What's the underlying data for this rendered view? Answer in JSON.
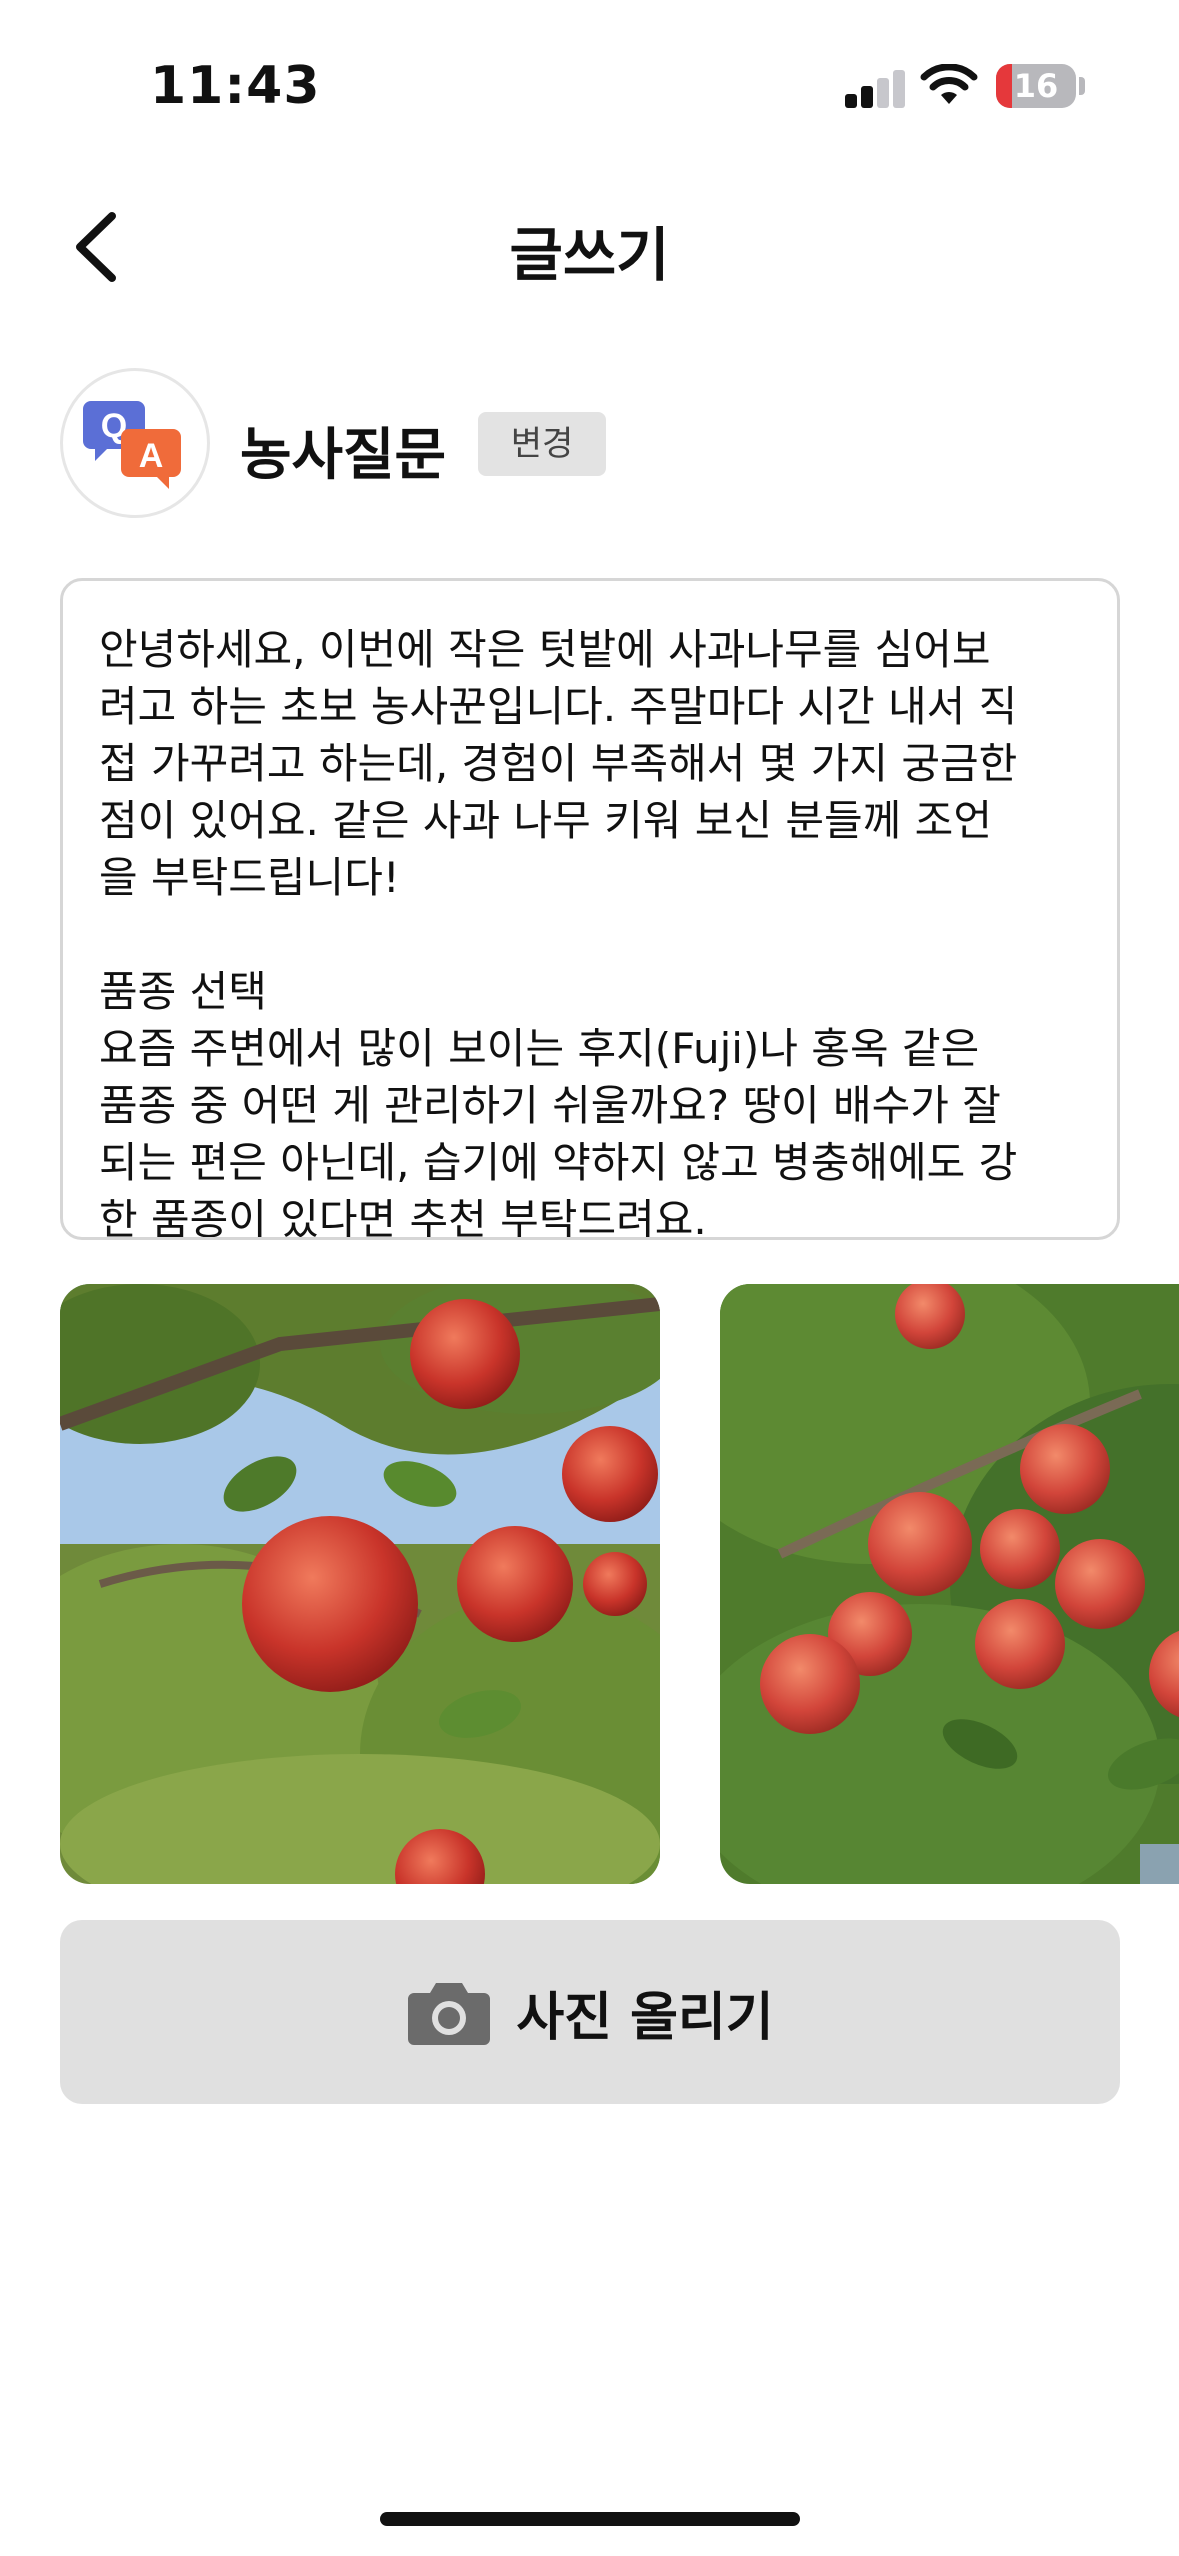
{
  "status_bar": {
    "time": "11:43",
    "battery_level": "16",
    "icons": [
      "signal-icon",
      "wifi-icon",
      "battery-icon"
    ]
  },
  "header": {
    "title": "글쓰기",
    "back_icon": "chevron-left-icon"
  },
  "category": {
    "icon": "qa-chat-icon",
    "icon_letters": [
      "Q",
      "A"
    ],
    "name": "농사질문",
    "change_label": "변경"
  },
  "post": {
    "body": "안녕하세요, 이번에 작은 텃밭에 사과나무를 심어보\n려고 하는 초보 농사꾼입니다. 주말마다 시간 내서 직\n접 가꾸려고 하는데, 경험이 부족해서 몇 가지 궁금한\n점이 있어요. 같은 사과 나무 키워 보신 분들께 조언\n을 부탁드립니다!\n\n품종 선택\n요즘 주변에서 많이 보이는 후지(Fuji)나 홍옥 같은\n품종 중 어떤 게 관리하기 쉬울까요? 땅이 배수가 잘\n되는 편은 아닌데, 습기에 약하지 않고 병충해에도 강\n한 품종이 있다면 추천 부탁드려요."
  },
  "photos": [
    {
      "subject": "apple-tree-photo",
      "count_visible": 1
    },
    {
      "subject": "apple-tree-photo",
      "count_visible": 1
    }
  ],
  "upload": {
    "icon": "camera-icon",
    "label": "사진 올리기"
  },
  "colors": {
    "accent_blue": "#5b6fd6",
    "accent_orange": "#f06b3a",
    "button_gray": "#e0e0e0",
    "battery_red": "#e5383b"
  }
}
